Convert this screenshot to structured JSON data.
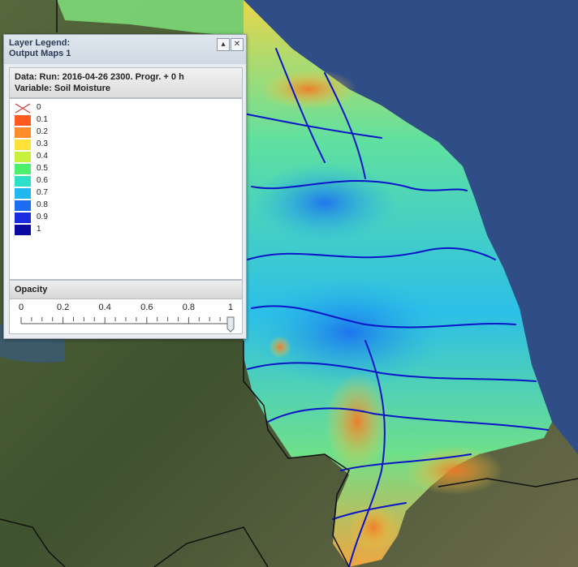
{
  "map": {
    "colors": {
      "sea": "#2f4d86",
      "land": "#4a5a34",
      "soil_dry": "#f4a838",
      "soil_mid": "#5fe08a",
      "soil_wet": "#22b8e8",
      "river": "#0a14c8",
      "border": "#111111"
    }
  },
  "legend_panel": {
    "title": "Layer Legend:\nOutput Maps 1",
    "data_line": "Data: Run: 2016-04-26 2300. Progr. + 0 h",
    "variable_line": "Variable: Soil Moisture",
    "items": [
      {
        "label": "0",
        "color": "none"
      },
      {
        "label": "0.1",
        "color": "#ff5a1f"
      },
      {
        "label": "0.2",
        "color": "#ff8c2a"
      },
      {
        "label": "0.3",
        "color": "#ffe13a"
      },
      {
        "label": "0.4",
        "color": "#c9f03a"
      },
      {
        "label": "0.5",
        "color": "#4cf06a"
      },
      {
        "label": "0.6",
        "color": "#2fe0c8"
      },
      {
        "label": "0.7",
        "color": "#21b8f0"
      },
      {
        "label": "0.8",
        "color": "#1a6cf0"
      },
      {
        "label": "0.9",
        "color": "#1a2ce0"
      },
      {
        "label": "1",
        "color": "#0a0aa0"
      }
    ],
    "opacity": {
      "heading": "Opacity",
      "ticks": [
        "0",
        "0.2",
        "0.4",
        "0.6",
        "0.8",
        "1"
      ],
      "value": 1
    },
    "buttons": {
      "collapse": "▴",
      "close": "✕"
    }
  }
}
